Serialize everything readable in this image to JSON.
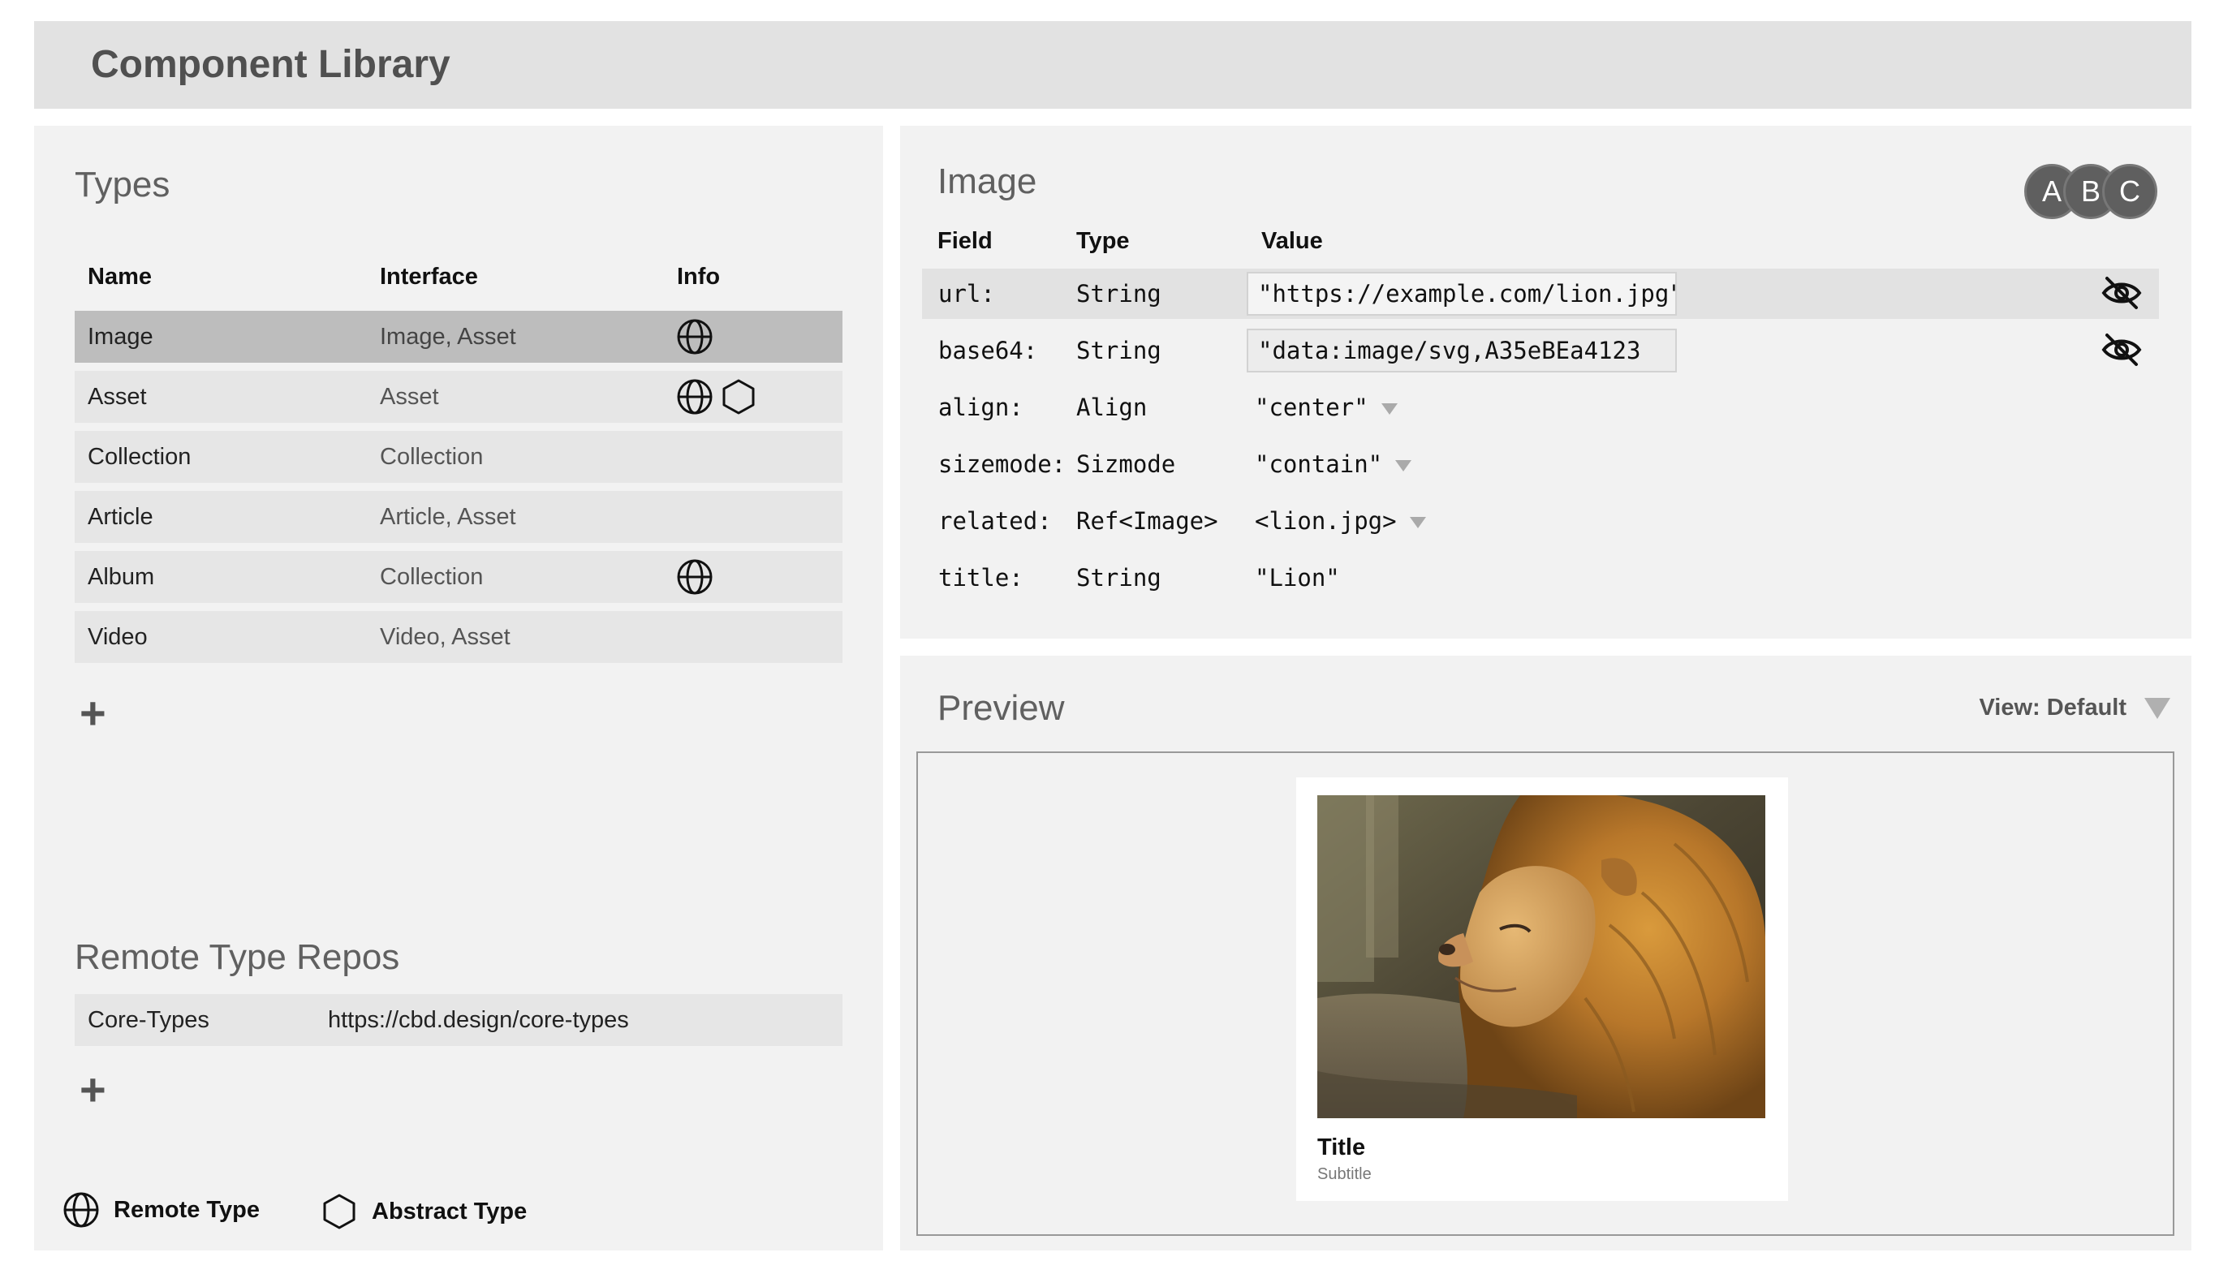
{
  "app": {
    "title": "Component Library"
  },
  "types": {
    "title": "Types",
    "columns": {
      "name": "Name",
      "interface": "Interface",
      "info": "Info"
    },
    "rows": [
      {
        "name": "Image",
        "interface": "Image, Asset",
        "info": [
          "globe-icon"
        ],
        "selected": true
      },
      {
        "name": "Asset",
        "interface": "Asset",
        "info": [
          "globe-icon",
          "hexagon-icon"
        ]
      },
      {
        "name": "Collection",
        "interface": "Collection",
        "info": []
      },
      {
        "name": "Article",
        "interface": "Article, Asset",
        "info": []
      },
      {
        "name": "Album",
        "interface": "Collection",
        "info": [
          "globe-icon"
        ]
      },
      {
        "name": "Video",
        "interface": "Video, Asset",
        "info": []
      }
    ],
    "add_label": "+"
  },
  "repos": {
    "title": "Remote Type Repos",
    "rows": [
      {
        "name": "Core-Types",
        "url": "https://cbd.design/core-types"
      }
    ],
    "add_label": "+"
  },
  "legend": {
    "remote": "Remote Type",
    "abstract": "Abstract Type"
  },
  "detail": {
    "title": "Image",
    "avatars": [
      "A",
      "B",
      "C"
    ],
    "columns": {
      "field": "Field",
      "type": "Type",
      "value": "Value"
    },
    "fields": [
      {
        "field": "url:",
        "type": "String",
        "value": "\"https://example.com/lion.jpg\"",
        "input": true,
        "hidden_toggle": true
      },
      {
        "field": "base64:",
        "type": "String",
        "value": "\"data:image/svg,A35eBEa4123",
        "input": true,
        "hidden_toggle": true
      },
      {
        "field": "align:",
        "type": "Align",
        "value": "\"center\"",
        "dropdown": true
      },
      {
        "field": "sizemode:",
        "type": "Sizmode",
        "value": "\"contain\"",
        "dropdown": true
      },
      {
        "field": "related:",
        "type": "Ref<Image>",
        "value": "<lion.jpg>",
        "dropdown": true
      },
      {
        "field": "title:",
        "type": "String",
        "value": "\"Lion\""
      }
    ]
  },
  "preview": {
    "title": "Preview",
    "view_label": "View: Default",
    "card": {
      "title": "Title",
      "subtitle": "Subtitle"
    }
  },
  "colors": {
    "panel": "#f2f2f2",
    "header": "#e2e2e2",
    "selected_row": "#bdbdbd",
    "row": "#e6e6e6",
    "avatar": "#5f5f5f"
  }
}
